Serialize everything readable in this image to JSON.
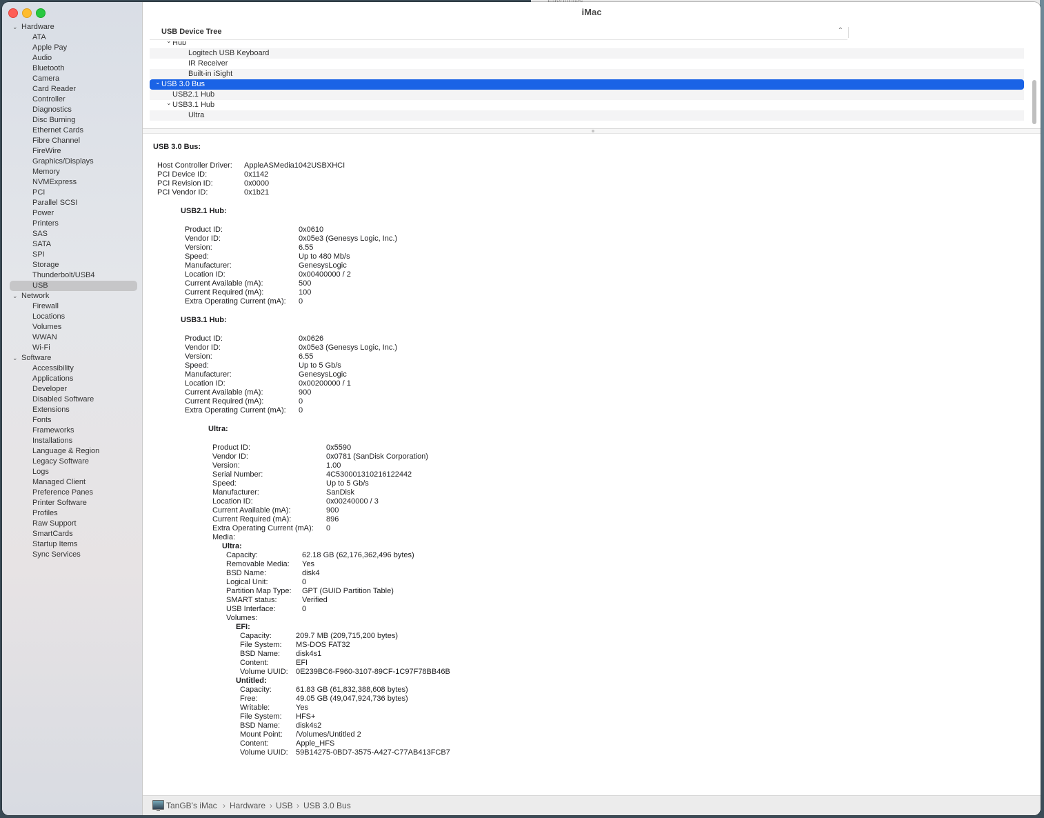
{
  "window_title": "iMac",
  "background_window": {
    "text": "Favourites"
  },
  "sidebar": {
    "groups": [
      {
        "label": "Hardware",
        "items": [
          "ATA",
          "Apple Pay",
          "Audio",
          "Bluetooth",
          "Camera",
          "Card Reader",
          "Controller",
          "Diagnostics",
          "Disc Burning",
          "Ethernet Cards",
          "Fibre Channel",
          "FireWire",
          "Graphics/Displays",
          "Memory",
          "NVMExpress",
          "PCI",
          "Parallel SCSI",
          "Power",
          "Printers",
          "SAS",
          "SATA",
          "SPI",
          "Storage",
          "Thunderbolt/USB4",
          "USB"
        ]
      },
      {
        "label": "Network",
        "items": [
          "Firewall",
          "Locations",
          "Volumes",
          "WWAN",
          "Wi-Fi"
        ]
      },
      {
        "label": "Software",
        "items": [
          "Accessibility",
          "Applications",
          "Developer",
          "Disabled Software",
          "Extensions",
          "Fonts",
          "Frameworks",
          "Installations",
          "Language & Region",
          "Legacy Software",
          "Logs",
          "Managed Client",
          "Preference Panes",
          "Printer Software",
          "Profiles",
          "Raw Support",
          "SmartCards",
          "Startup Items",
          "Sync Services"
        ]
      }
    ],
    "selected": "USB"
  },
  "tree": {
    "header": "USB Device Tree",
    "rows": [
      {
        "label": "Hub",
        "indent": 1,
        "chevron": true,
        "alt": false
      },
      {
        "label": "Logitech USB Keyboard",
        "indent": 2,
        "chevron": false,
        "alt": true
      },
      {
        "label": "IR Receiver",
        "indent": 2,
        "chevron": false,
        "alt": false
      },
      {
        "label": "Built-in iSight",
        "indent": 2,
        "chevron": false,
        "alt": true
      },
      {
        "label": "USB 3.0 Bus",
        "indent": 0,
        "chevron": true,
        "selected": true
      },
      {
        "label": "USB2.1 Hub",
        "indent": 1,
        "chevron": false,
        "alt": true
      },
      {
        "label": "USB3.1 Hub",
        "indent": 1,
        "chevron": true,
        "alt": false
      },
      {
        "label": "Ultra",
        "indent": 2,
        "chevron": false,
        "alt": true
      },
      {
        "label": "",
        "indent": 0,
        "chevron": false,
        "alt": false
      }
    ]
  },
  "detail": {
    "bus": {
      "title": "USB 3.0 Bus:",
      "props": [
        [
          "Host Controller Driver:",
          "AppleASMedia1042USBXHCI"
        ],
        [
          "PCI Device ID:",
          "0x1142"
        ],
        [
          "PCI Revision ID:",
          "0x0000"
        ],
        [
          "PCI Vendor ID:",
          "0x1b21"
        ]
      ]
    },
    "usb21": {
      "title": "USB2.1 Hub:",
      "props": [
        [
          "Product ID:",
          "0x0610"
        ],
        [
          "Vendor ID:",
          "0x05e3  (Genesys Logic, Inc.)"
        ],
        [
          "Version:",
          "6.55"
        ],
        [
          "Speed:",
          "Up to 480 Mb/s"
        ],
        [
          "Manufacturer:",
          "GenesysLogic"
        ],
        [
          "Location ID:",
          "0x00400000 / 2"
        ],
        [
          "Current Available (mA):",
          "500"
        ],
        [
          "Current Required (mA):",
          "100"
        ],
        [
          "Extra Operating Current (mA):",
          "0"
        ]
      ]
    },
    "usb31": {
      "title": "USB3.1 Hub:",
      "props": [
        [
          "Product ID:",
          "0x0626"
        ],
        [
          "Vendor ID:",
          "0x05e3  (Genesys Logic, Inc.)"
        ],
        [
          "Version:",
          "6.55"
        ],
        [
          "Speed:",
          "Up to 5 Gb/s"
        ],
        [
          "Manufacturer:",
          "GenesysLogic"
        ],
        [
          "Location ID:",
          "0x00200000 / 1"
        ],
        [
          "Current Available (mA):",
          "900"
        ],
        [
          "Current Required (mA):",
          "0"
        ],
        [
          "Extra Operating Current (mA):",
          "0"
        ]
      ]
    },
    "ultra": {
      "title": "Ultra:",
      "props": [
        [
          "Product ID:",
          "0x5590"
        ],
        [
          "Vendor ID:",
          "0x0781  (SanDisk Corporation)"
        ],
        [
          "Version:",
          "1.00"
        ],
        [
          "Serial Number:",
          "4C530001310216122442"
        ],
        [
          "Speed:",
          "Up to 5 Gb/s"
        ],
        [
          "Manufacturer:",
          "SanDisk"
        ],
        [
          "Location ID:",
          "0x00240000 / 3"
        ],
        [
          "Current Available (mA):",
          "900"
        ],
        [
          "Current Required (mA):",
          "896"
        ],
        [
          "Extra Operating Current (mA):",
          "0"
        ],
        [
          "Media:",
          ""
        ]
      ]
    },
    "media": {
      "title": "Ultra:",
      "props": [
        [
          "Capacity:",
          "62.18 GB (62,176,362,496 bytes)"
        ],
        [
          "Removable Media:",
          "Yes"
        ],
        [
          "BSD Name:",
          "disk4"
        ],
        [
          "Logical Unit:",
          "0"
        ],
        [
          "Partition Map Type:",
          "GPT (GUID Partition Table)"
        ],
        [
          "SMART status:",
          "Verified"
        ],
        [
          "USB Interface:",
          "0"
        ],
        [
          "Volumes:",
          ""
        ]
      ]
    },
    "efi": {
      "title": "EFI:",
      "props": [
        [
          "Capacity:",
          "209.7 MB (209,715,200 bytes)"
        ],
        [
          "File System:",
          "MS-DOS FAT32"
        ],
        [
          "BSD Name:",
          "disk4s1"
        ],
        [
          "Content:",
          "EFI"
        ],
        [
          "Volume UUID:",
          "0E239BC6-F960-3107-89CF-1C97F78BB46B"
        ]
      ]
    },
    "untitled": {
      "title": "Untitled:",
      "props": [
        [
          "Capacity:",
          "61.83 GB (61,832,388,608 bytes)"
        ],
        [
          "Free:",
          "49.05 GB (49,047,924,736 bytes)"
        ],
        [
          "Writable:",
          "Yes"
        ],
        [
          "File System:",
          "HFS+"
        ],
        [
          "BSD Name:",
          "disk4s2"
        ],
        [
          "Mount Point:",
          "/Volumes/Untitled 2"
        ],
        [
          "Content:",
          "Apple_HFS"
        ],
        [
          "Volume UUID:",
          "59B14275-0BD7-3575-A427-C77AB413FCB7"
        ]
      ]
    }
  },
  "breadcrumb": [
    "TanGB's iMac",
    "Hardware",
    "USB",
    "USB 3.0 Bus"
  ],
  "breadcrumb_separator": "›",
  "icons": {
    "computer": "imac-icon",
    "sort": "chevron-up-icon",
    "expand": "chevron-down-icon"
  },
  "colors": {
    "selection": "#1a63e6",
    "sidebar_selection": "#c6c6c8",
    "close": "#fe5f57",
    "minimize": "#febc2e",
    "maximize": "#28c840"
  }
}
